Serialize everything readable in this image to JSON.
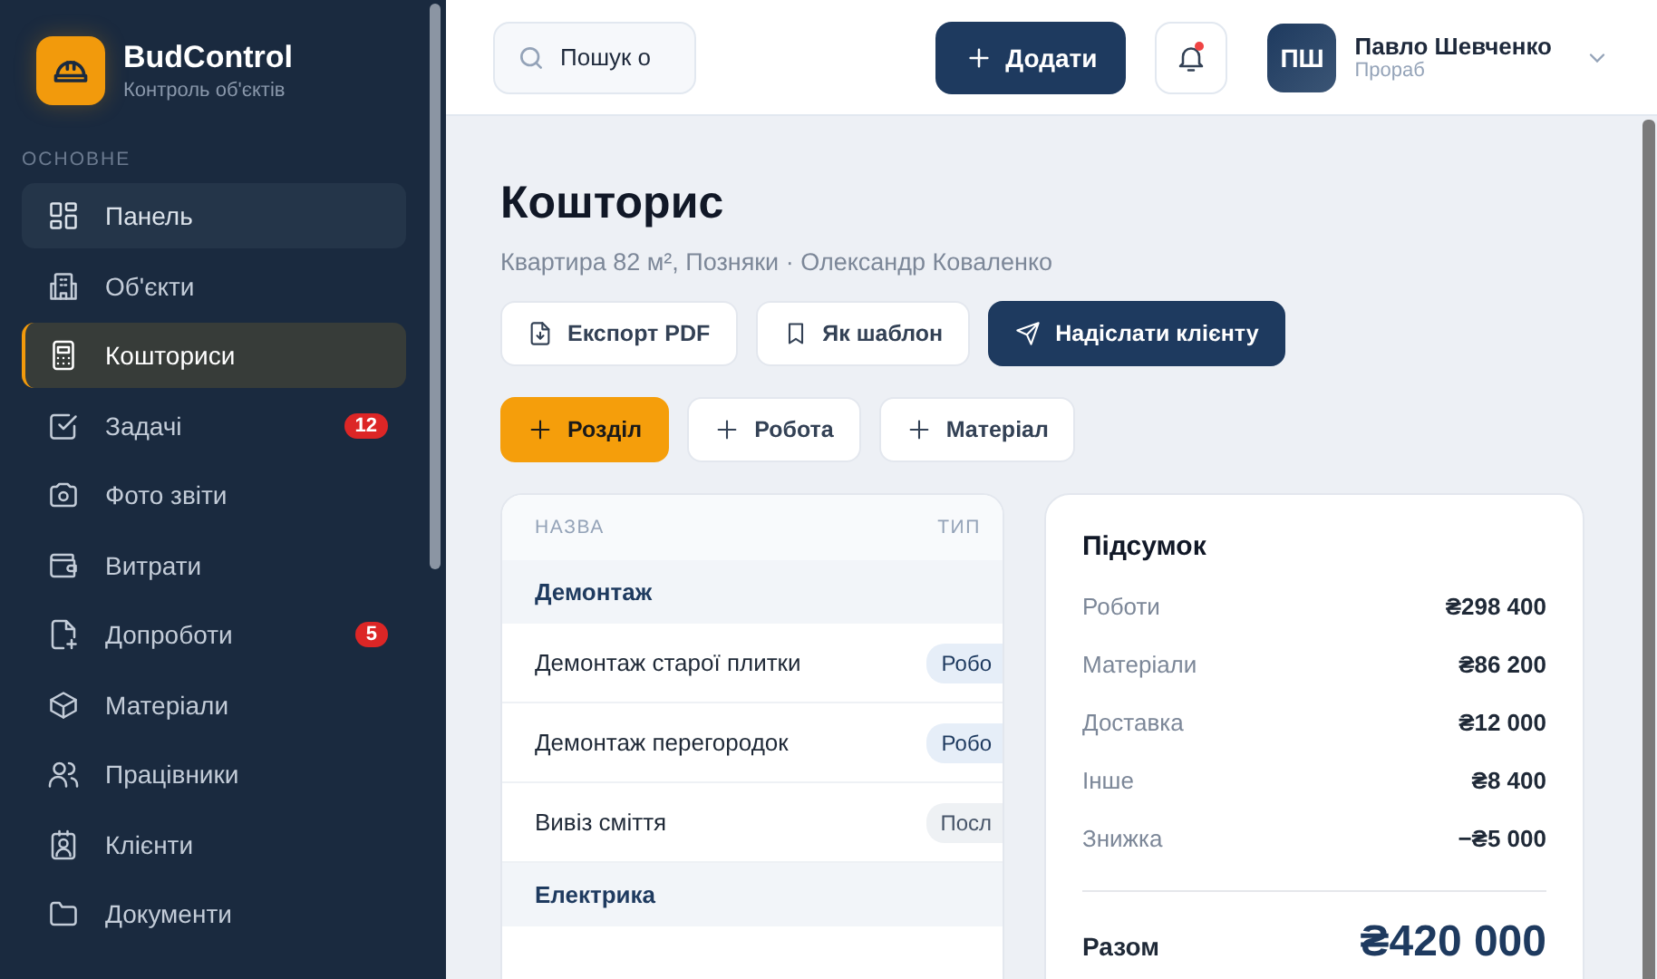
{
  "brand": {
    "name": "BudControl",
    "tagline": "Контроль об'єктів"
  },
  "sidebar": {
    "section": "ОСНОВНЕ",
    "items": [
      {
        "label": "Панель",
        "selected": false,
        "hovered": true
      },
      {
        "label": "Об'єкти",
        "selected": false,
        "hovered": false
      },
      {
        "label": "Кошториси",
        "selected": true,
        "hovered": false
      },
      {
        "label": "Задачі",
        "selected": false,
        "hovered": false,
        "badge": "12"
      },
      {
        "label": "Фото звіти",
        "selected": false,
        "hovered": false
      },
      {
        "label": "Витрати",
        "selected": false,
        "hovered": false
      },
      {
        "label": "Допроботи",
        "selected": false,
        "hovered": false,
        "badge": "5"
      },
      {
        "label": "Матеріали",
        "selected": false,
        "hovered": false
      },
      {
        "label": "Працівники",
        "selected": false,
        "hovered": false
      },
      {
        "label": "Клієнти",
        "selected": false,
        "hovered": false
      },
      {
        "label": "Документи",
        "selected": false,
        "hovered": false
      }
    ]
  },
  "header": {
    "search": {
      "value": "Пошук о"
    },
    "add_button": "Додати",
    "notifications": {
      "unread": true
    },
    "user": {
      "initials": "ПШ",
      "name": "Павло Шевченко",
      "role": "Прораб"
    }
  },
  "page": {
    "title": "Кошторис",
    "subtitle": "Квартира 82 м², Позняки · Олександр Коваленко",
    "actions": [
      {
        "label": "Експорт PDF",
        "kind": "secondary"
      },
      {
        "label": "Як шаблон",
        "kind": "secondary"
      },
      {
        "label": "Надіслати клієнту",
        "kind": "primary"
      }
    ],
    "add_buttons": [
      {
        "label": "Розділ",
        "kind": "accent"
      },
      {
        "label": "Робота",
        "kind": "secondary"
      },
      {
        "label": "Матеріал",
        "kind": "secondary"
      }
    ]
  },
  "table": {
    "columns": [
      "НАЗВА",
      "ТИП"
    ],
    "rows": [
      {
        "kind": "group",
        "name": "Демонтаж"
      },
      {
        "kind": "item",
        "name": "Демонтаж старої плитки",
        "type": {
          "label": "Робо",
          "kind": "work"
        }
      },
      {
        "kind": "item",
        "name": "Демонтаж перегородок",
        "type": {
          "label": "Робо",
          "kind": "work"
        }
      },
      {
        "kind": "item",
        "name": "Вивіз сміття",
        "type": {
          "label": "Посл",
          "kind": "service"
        }
      },
      {
        "kind": "group",
        "name": "Електрика"
      }
    ]
  },
  "summary": {
    "title": "Підсумок",
    "lines": [
      {
        "label": "Роботи",
        "value": "₴298 400"
      },
      {
        "label": "Матеріали",
        "value": "₴86 200"
      },
      {
        "label": "Доставка",
        "value": "₴12 000"
      },
      {
        "label": "Інше",
        "value": "₴8 400"
      },
      {
        "label": "Знижка",
        "value": "−₴5 000"
      }
    ],
    "total": {
      "label": "Разом",
      "value": "₴420 000"
    }
  }
}
